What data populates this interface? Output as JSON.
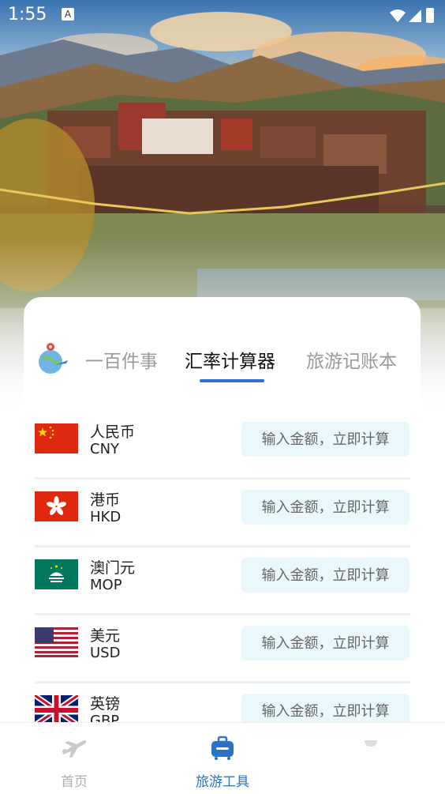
{
  "status_bar": {
    "time": "1:55",
    "notif_icon": "A"
  },
  "tabs": [
    {
      "label": "一百件事",
      "active": false
    },
    {
      "label": "汇率计算器",
      "active": true
    },
    {
      "label": "旅游记账本",
      "active": false
    }
  ],
  "currencies": [
    {
      "name": "人民币",
      "code": "CNY",
      "flag": "china-flag-icon",
      "placeholder": "输入金额，立即计算"
    },
    {
      "name": "港币",
      "code": "HKD",
      "flag": "hong-kong-flag-icon",
      "placeholder": "输入金额，立即计算"
    },
    {
      "name": "澳门元",
      "code": "MOP",
      "flag": "macau-flag-icon",
      "placeholder": "输入金额，立即计算"
    },
    {
      "name": "美元",
      "code": "USD",
      "flag": "us-flag-icon",
      "placeholder": "输入金额，立即计算"
    },
    {
      "name": "英镑",
      "code": "GBP",
      "flag": "uk-flag-icon",
      "placeholder": "输入金额，立即计算"
    }
  ],
  "bottom_nav": [
    {
      "label": "首页",
      "icon": "airplane-icon",
      "active": false
    },
    {
      "label": "旅游工具",
      "icon": "suitcase-icon",
      "active": true
    },
    {
      "label": "",
      "icon": "third-tab-icon",
      "active": false
    }
  ],
  "colors": {
    "accent": "#2b72c9",
    "tab_underline": "#2f6fd0",
    "input_bg": "#eaf8fb"
  }
}
